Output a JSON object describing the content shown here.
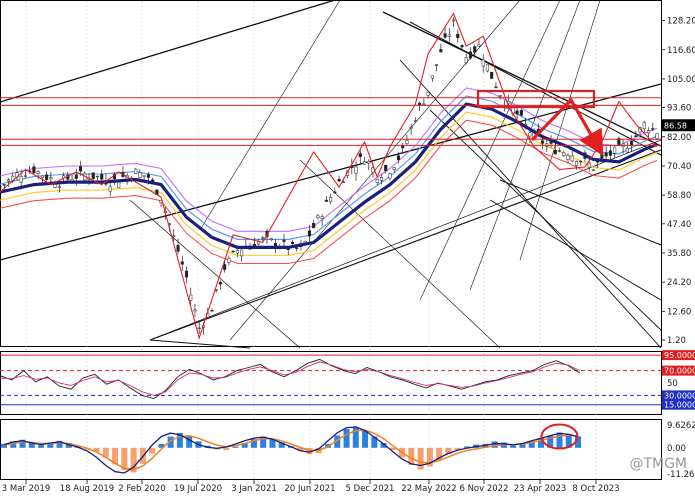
{
  "chart_data": [
    {
      "panel": "price",
      "type": "candlestick",
      "y_ticks": [
        "128.20",
        "116.60",
        "105.00",
        "93.60",
        "82.00",
        "70.40",
        "58.80",
        "47.40",
        "35.80",
        "24.20",
        "12.60",
        "1.20"
      ],
      "y_range": [
        1.2,
        134.0
      ],
      "current_price": "86.58",
      "current_price_color": "#000000",
      "ma_color": "#1b1f7a",
      "zigzag_color": "#e02020",
      "horizontal_levels": [
        97.5,
        94.5,
        81.0,
        78.6
      ],
      "close_path": [
        [
          0,
          62
        ],
        [
          4,
          67
        ],
        [
          8,
          69
        ],
        [
          11,
          66
        ],
        [
          14,
          64
        ],
        [
          17,
          66
        ],
        [
          20,
          67
        ],
        [
          23,
          66
        ],
        [
          26,
          64
        ],
        [
          29,
          66
        ],
        [
          32,
          68
        ],
        [
          35,
          66
        ],
        [
          38,
          58
        ],
        [
          41,
          42
        ],
        [
          44,
          26
        ],
        [
          47,
          6
        ],
        [
          50,
          14
        ],
        [
          53,
          30
        ],
        [
          56,
          37
        ],
        [
          59,
          39
        ],
        [
          62,
          41
        ],
        [
          65,
          40
        ],
        [
          68,
          38
        ],
        [
          71,
          37
        ],
        [
          74,
          46
        ],
        [
          77,
          55
        ],
        [
          80,
          64
        ],
        [
          83,
          70
        ],
        [
          86,
          74
        ],
        [
          89,
          67
        ],
        [
          92,
          69
        ],
        [
          95,
          76
        ],
        [
          98,
          90
        ],
        [
          101,
          100
        ],
        [
          104,
          116
        ],
        [
          107,
          127
        ],
        [
          110,
          114
        ],
        [
          113,
          118
        ],
        [
          116,
          106
        ],
        [
          119,
          96
        ],
        [
          122,
          91
        ],
        [
          125,
          84
        ],
        [
          128,
          80
        ],
        [
          131,
          77
        ],
        [
          134,
          76
        ],
        [
          137,
          73
        ],
        [
          140,
          70
        ],
        [
          143,
          74
        ],
        [
          146,
          77
        ],
        [
          149,
          80
        ],
        [
          152,
          87
        ],
        [
          155,
          84
        ]
      ],
      "ma_path": [
        [
          0,
          60
        ],
        [
          8,
          63
        ],
        [
          16,
          64
        ],
        [
          24,
          64
        ],
        [
          32,
          65
        ],
        [
          38,
          63
        ],
        [
          44,
          50
        ],
        [
          50,
          42
        ],
        [
          56,
          38
        ],
        [
          62,
          38
        ],
        [
          68,
          38
        ],
        [
          74,
          40
        ],
        [
          80,
          48
        ],
        [
          86,
          56
        ],
        [
          92,
          63
        ],
        [
          98,
          72
        ],
        [
          104,
          85
        ],
        [
          110,
          95
        ],
        [
          116,
          93
        ],
        [
          122,
          88
        ],
        [
          128,
          82
        ],
        [
          134,
          78
        ],
        [
          140,
          73
        ],
        [
          146,
          72
        ],
        [
          152,
          77
        ],
        [
          155,
          79
        ]
      ],
      "zigzag": [
        [
          0,
          60
        ],
        [
          6,
          69
        ],
        [
          12,
          63
        ],
        [
          18,
          68
        ],
        [
          24,
          63
        ],
        [
          28,
          68
        ],
        [
          38,
          58
        ],
        [
          47,
          2
        ],
        [
          55,
          43
        ],
        [
          62,
          40
        ],
        [
          74,
          76
        ],
        [
          80,
          62
        ],
        [
          86,
          80
        ],
        [
          89,
          66
        ],
        [
          92,
          78
        ],
        [
          98,
          95
        ],
        [
          101,
          115
        ],
        [
          107,
          131
        ],
        [
          110,
          118
        ],
        [
          114,
          122
        ],
        [
          120,
          94
        ],
        [
          126,
          78
        ],
        [
          132,
          69
        ],
        [
          138,
          70
        ],
        [
          142,
          80
        ],
        [
          146,
          96
        ],
        [
          150,
          87
        ],
        [
          155,
          78
        ]
      ],
      "x_dates": [
        "3 Mar 2019",
        "18 Aug 2019",
        "2 Feb 2020",
        "19 Jul 2020",
        "3 Jan 2021",
        "20 Jun 2021",
        "5 Dec 2021",
        "22 May 2022",
        "6 Nov 2022",
        "23 Apr 2023",
        "8 Oct 2023"
      ]
    },
    {
      "panel": "oscillator",
      "type": "line",
      "level_labels": [
        "95.0000",
        "70.0000",
        "30.0000",
        "15.0000"
      ],
      "levels": [
        95,
        70,
        30,
        15
      ],
      "mid_label": "50",
      "y_range": [
        0,
        100
      ],
      "series": [
        {
          "values": [
            62,
            55,
            70,
            52,
            60,
            45,
            40,
            58,
            64,
            48,
            55,
            42,
            30,
            25,
            38,
            60,
            72,
            65,
            55,
            60,
            70,
            75,
            80,
            68,
            60,
            70,
            82,
            88,
            78,
            70,
            65,
            75,
            68,
            60,
            55,
            48,
            42,
            50,
            45,
            40,
            46,
            52,
            55,
            62,
            66,
            70,
            80,
            86,
            78,
            66
          ]
        },
        {
          "values": [
            58,
            57,
            62,
            56,
            58,
            50,
            46,
            54,
            60,
            52,
            54,
            46,
            36,
            30,
            36,
            55,
            66,
            64,
            58,
            59,
            66,
            72,
            76,
            70,
            63,
            67,
            77,
            84,
            79,
            72,
            68,
            72,
            68,
            62,
            57,
            51,
            46,
            49,
            46,
            43,
            45,
            50,
            54,
            59,
            64,
            68,
            76,
            82,
            79,
            70
          ]
        }
      ]
    },
    {
      "panel": "macd",
      "type": "bar",
      "y_labels": [
        "9.6262",
        "0.00",
        "-11.2678"
      ],
      "y_range": [
        -11.2678,
        9.6262
      ],
      "histogram": [
        1.5,
        2.4,
        3.0,
        2.2,
        1.0,
        1.6,
        2.6,
        1.8,
        0.6,
        -0.4,
        -1.6,
        -3.5,
        -6.2,
        -8.4,
        -9.2,
        -6.0,
        -2.2,
        1.4,
        4.2,
        5.5,
        4.6,
        2.4,
        0.8,
        -0.6,
        -0.8,
        0.4,
        1.8,
        3.2,
        4.2,
        3.4,
        2.0,
        0.6,
        -1.0,
        -2.4,
        -2.0,
        1.4,
        4.6,
        7.0,
        7.6,
        6.4,
        4.2,
        1.8,
        -0.8,
        -3.6,
        -6.4,
        -8.1,
        -7.0,
        -4.6,
        -2.4,
        -0.8,
        0.5,
        1.2,
        1.5,
        2.4,
        2.0,
        0.8,
        1.2,
        2.3,
        3.6,
        4.6,
        5.7,
        5.2,
        4.3
      ],
      "macd_line": [
        1.2,
        2.2,
        2.6,
        1.8,
        1.2,
        1.8,
        2.2,
        1.2,
        0.2,
        -1.2,
        -3.6,
        -6.6,
        -8.9,
        -9.4,
        -7.2,
        -3.2,
        1.0,
        4.2,
        5.5,
        4.8,
        3.0,
        1.2,
        0.2,
        -0.2,
        0.3,
        1.4,
        2.6,
        3.6,
        4.0,
        3.2,
        1.8,
        0.4,
        -1.1,
        -1.6,
        -0.4,
        2.6,
        5.6,
        7.5,
        7.8,
        6.4,
        4.0,
        1.4,
        -1.4,
        -4.2,
        -6.0,
        -6.6,
        -5.7,
        -3.8,
        -2.1,
        -0.9,
        -0.1,
        0.4,
        0.9,
        1.6,
        1.5,
        1.1,
        1.6,
        2.6,
        3.6,
        4.5,
        5.4,
        5.0,
        4.1
      ],
      "signal_line": [
        1.0,
        1.6,
        2.2,
        2.0,
        1.6,
        1.6,
        1.9,
        1.6,
        0.8,
        -0.2,
        -1.6,
        -3.6,
        -5.8,
        -7.6,
        -8.1,
        -6.8,
        -4.0,
        -0.4,
        2.6,
        4.2,
        4.5,
        3.6,
        2.2,
        1.0,
        0.4,
        0.8,
        1.6,
        2.6,
        3.4,
        3.4,
        2.6,
        1.4,
        0.1,
        -0.9,
        -1.0,
        0.4,
        2.8,
        5.0,
        6.4,
        6.6,
        5.4,
        3.4,
        0.8,
        -1.8,
        -4.0,
        -5.4,
        -5.6,
        -4.8,
        -3.4,
        -2.0,
        -1.0,
        -0.4,
        0.2,
        0.8,
        1.2,
        1.2,
        1.4,
        2.0,
        2.8,
        3.6,
        4.4,
        4.7,
        4.4
      ],
      "bar_up_color": "#2d7fe0",
      "bar_down_color": "#f4a070",
      "macd_color": "#1b1f7a",
      "signal_color": "#f08020"
    }
  ],
  "watermark": "@TMGM"
}
